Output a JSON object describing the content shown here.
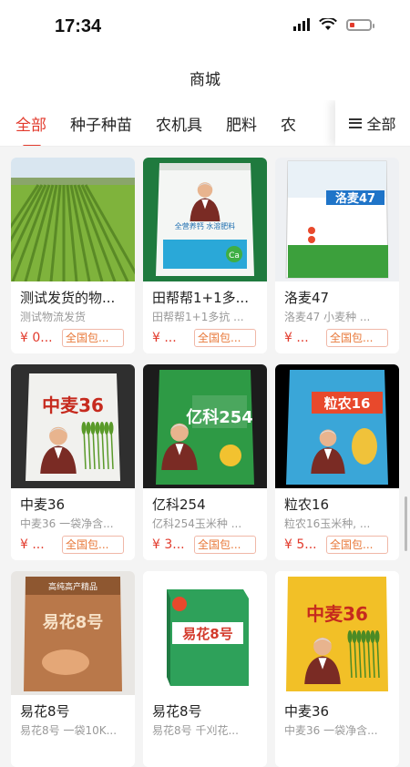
{
  "status": {
    "time": "17:34",
    "battery_level": 0.15
  },
  "nav": {
    "title": "商城"
  },
  "tabs": [
    {
      "label": "全部",
      "active": true
    },
    {
      "label": "种子种苗",
      "active": false
    },
    {
      "label": "农机具",
      "active": false
    },
    {
      "label": "肥料",
      "active": false
    },
    {
      "label": "农",
      "active": false
    }
  ],
  "tab_all": {
    "label": "全部",
    "icon": "menu-icon"
  },
  "colors": {
    "accent": "#e23a2c",
    "tag": "#e8793a"
  },
  "products": [
    {
      "title": "测试发货的物...",
      "subtitle": "测试物流发货",
      "price": "¥ 0...",
      "tag": "全国包...",
      "image": "wheat-field"
    },
    {
      "title": "田帮帮1+1多...",
      "subtitle": "田帮帮1+1多抗 ...",
      "price": "¥ ...",
      "tag": "全国包...",
      "image": "fertilizer-bag",
      "bag_text": "全营养钙 水溶肥料"
    },
    {
      "title": "洛麦47",
      "subtitle": "洛麦47 小麦种 ...",
      "price": "¥ ...",
      "tag": "全国包...",
      "image": "seed-bag-white",
      "bag_text": "洛麦47"
    },
    {
      "title": "中麦36",
      "subtitle": "中麦36 一袋净含...",
      "price": "¥ ...",
      "tag": "全国包...",
      "image": "seed-bag-zhongmai",
      "bag_text": "中麦36"
    },
    {
      "title": "亿科254",
      "subtitle": "亿科254玉米种 ...",
      "price": "¥ 3...",
      "tag": "全国包...",
      "image": "seed-bag-green",
      "bag_text": "亿科254"
    },
    {
      "title": "粒农16",
      "subtitle": "粒农16玉米种, ...",
      "price": "¥ 5...",
      "tag": "全国包...",
      "image": "seed-bag-blue",
      "bag_text": "粒农16"
    },
    {
      "title": "易花8号",
      "subtitle": "易花8号 一袋10K...",
      "price": "",
      "tag": "",
      "image": "seed-bag-brown",
      "bag_text": "易花8号"
    },
    {
      "title": "易花8号",
      "subtitle": "易花8号 千刈花...",
      "price": "",
      "tag": "",
      "image": "seed-box",
      "bag_text": "易花8号"
    },
    {
      "title": "中麦36",
      "subtitle": "中麦36 一袋净含...",
      "price": "",
      "tag": "",
      "image": "seed-bag-yellow",
      "bag_text": "中麦36"
    }
  ]
}
